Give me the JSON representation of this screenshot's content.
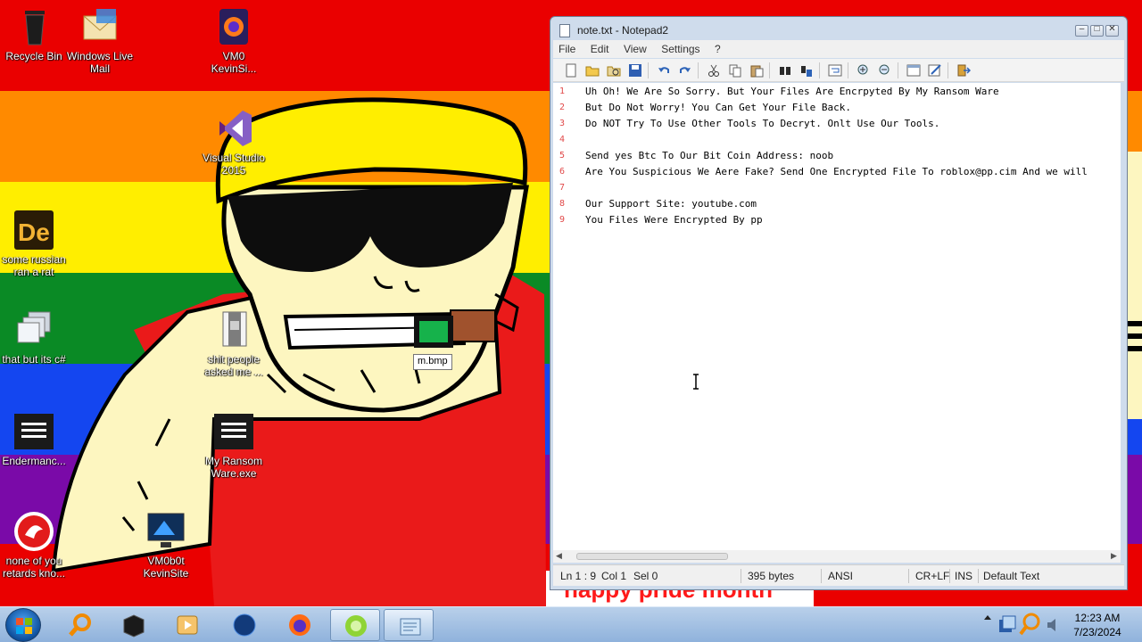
{
  "desktop": {
    "icons": [
      {
        "label": "Recycle Bin"
      },
      {
        "label": "Windows Live Mail"
      },
      {
        "label": "VM0 KevinSi..."
      },
      {
        "label": "Visual Studio 2015"
      },
      {
        "label": "some russian ran a rat"
      },
      {
        "label": "that but its c#"
      },
      {
        "label": "shit people asked me ..."
      },
      {
        "label": "Endermanc..."
      },
      {
        "label": "My Ransom Ware.exe"
      },
      {
        "label": "none of you retards kno..."
      },
      {
        "label": "VM0b0t KevinSite"
      }
    ],
    "drag_tooltip": "m.bmp",
    "wallpaper_caption": "happy pride month"
  },
  "notepad": {
    "title": "note.txt - Notepad2",
    "menu": [
      "File",
      "Edit",
      "View",
      "Settings",
      "?"
    ],
    "lines": [
      {
        "num": "1",
        "text": "Uh Oh! We Are So Sorry. But Your Files Are Encrpyted By My Ransom Ware"
      },
      {
        "num": "2",
        "text": "But Do Not Worry! You Can Get Your File Back."
      },
      {
        "num": "3",
        "text": "Do NOT Try To Use Other Tools To Decryt. Onlt Use Our Tools."
      },
      {
        "num": "4",
        "text": ""
      },
      {
        "num": "5",
        "text": "Send yes Btc To Our Bit Coin Address: noob"
      },
      {
        "num": "6",
        "text": "Are You Suspicious We Aere Fake? Send One Encrypted File To roblox@pp.cim And we will"
      },
      {
        "num": "7",
        "text": ""
      },
      {
        "num": "8",
        "text": "Our Support Site: youtube.com"
      },
      {
        "num": "9",
        "text": "You Files Were Encrypted By pp"
      }
    ],
    "status": {
      "position": "Ln 1 : 9",
      "col": "Col 1",
      "sel": "Sel 0",
      "size": "395 bytes",
      "encoding": "ANSI",
      "eol": "CR+LF",
      "mode": "INS",
      "scheme": "Default Text"
    }
  },
  "taskbar": {
    "clock_time": "12:23 AM",
    "clock_date": "7/23/2024"
  },
  "colors": {
    "line_number": "#e14a4a",
    "taskbar": "#a8c4e6",
    "window_frame": "#cfdcec"
  }
}
